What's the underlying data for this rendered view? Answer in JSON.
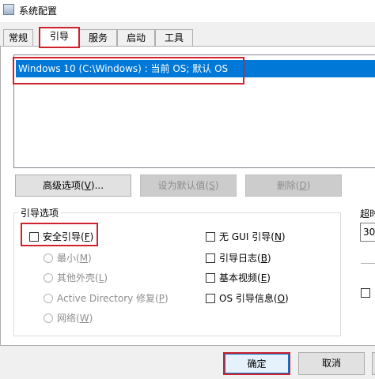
{
  "window": {
    "title": "系统配置"
  },
  "tabs": [
    {
      "label": "常规"
    },
    {
      "label": "引导"
    },
    {
      "label": "服务"
    },
    {
      "label": "启动"
    },
    {
      "label": "工具"
    }
  ],
  "os_list": {
    "items": [
      {
        "label": "Windows 10 (C:\\Windows) : 当前 OS; 默认 OS",
        "selected": true
      }
    ]
  },
  "buttons": {
    "advanced": {
      "label": "高级选项(",
      "key": "V",
      "suffix": ")..."
    },
    "set_default": {
      "label": "设为默认值(",
      "key": "S",
      "suffix": ")"
    },
    "delete": {
      "label": "删除(",
      "key": "D",
      "suffix": ")"
    },
    "ok": {
      "label": "确定"
    },
    "cancel": {
      "label": "取消"
    }
  },
  "boot_options": {
    "title": "引导选项",
    "safe_boot": {
      "label": "安全引导(",
      "key": "F",
      "suffix": ")",
      "checked": false
    },
    "minimal": {
      "label": "最小(",
      "key": "M",
      "suffix": ")"
    },
    "alternate_shell": {
      "label": "其他外壳(",
      "key": "L",
      "suffix": ")"
    },
    "active_directory": {
      "label": "Active Directory 修复(",
      "key": "P",
      "suffix": ")"
    },
    "network": {
      "label": "网络(",
      "key": "W",
      "suffix": ")"
    },
    "no_gui": {
      "label": "无 GUI 引导(",
      "key": "N",
      "suffix": ")",
      "checked": false
    },
    "boot_log": {
      "label": "引导日志(",
      "key": "B",
      "suffix": ")",
      "checked": false
    },
    "base_video": {
      "label": "基本视频(",
      "key": "E",
      "suffix": ")",
      "checked": false
    },
    "os_boot_info": {
      "label": "OS 引导信息(",
      "key": "O",
      "suffix": ")",
      "checked": false
    }
  },
  "timeout": {
    "label": "超时",
    "value": "30"
  },
  "colors": {
    "selection": "#0078d7",
    "highlight_box": "#d0222c"
  }
}
